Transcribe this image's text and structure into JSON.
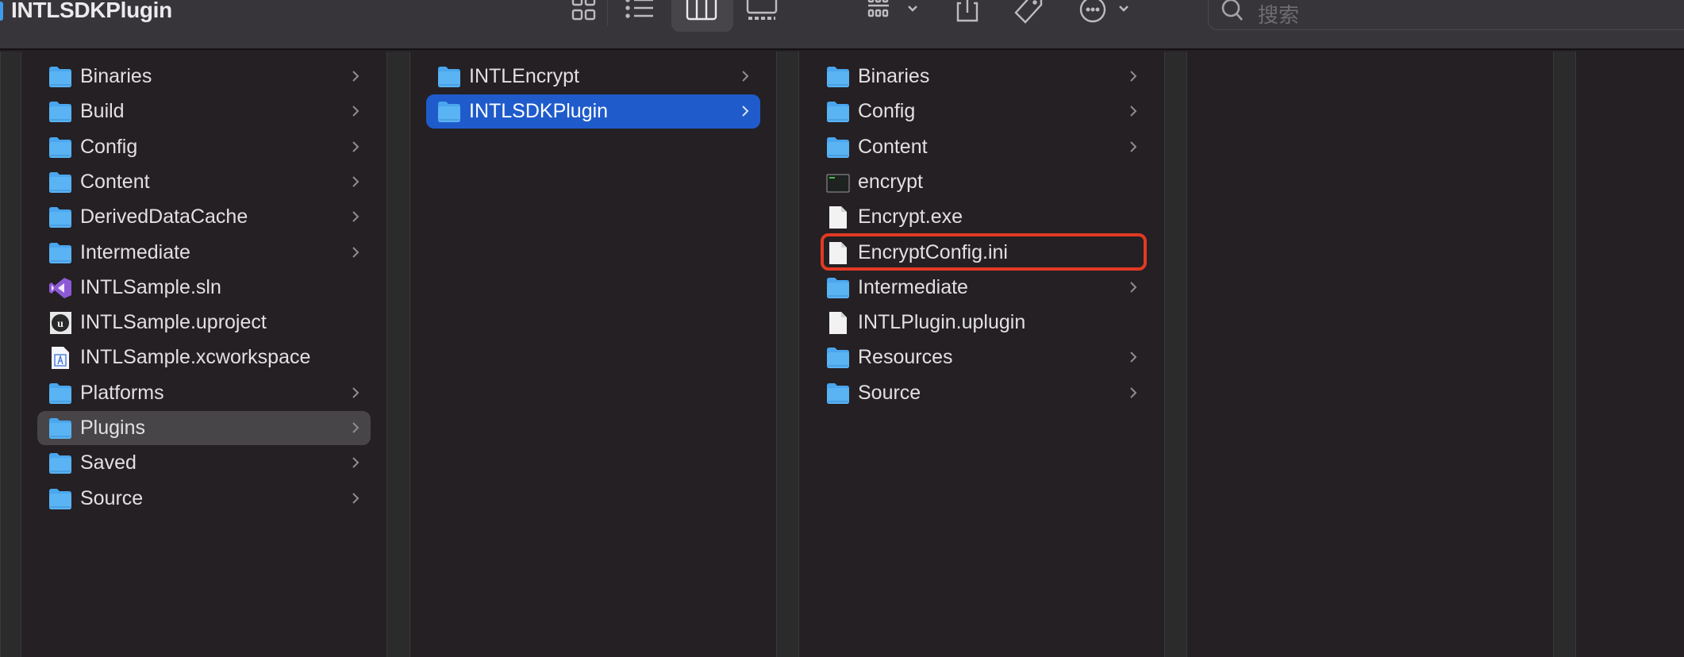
{
  "window": {
    "title": "INTLSDKPlugin"
  },
  "toolbar": {
    "view_buttons": [
      {
        "name": "icon-view",
        "icon": "grid-icon",
        "selected": false
      },
      {
        "name": "list-view",
        "icon": "list-icon",
        "selected": false
      },
      {
        "name": "column-view",
        "icon": "columns-icon",
        "selected": true
      },
      {
        "name": "gallery-view",
        "icon": "gallery-icon",
        "selected": false
      }
    ],
    "group_button": {
      "icon": "group-icon",
      "has_dropdown": true
    },
    "share_button": {
      "icon": "share-icon"
    },
    "tag_button": {
      "icon": "tag-icon"
    },
    "more_button": {
      "icon": "ellipsis-circle-icon",
      "has_dropdown": true
    },
    "search": {
      "placeholder": "搜索",
      "value": ""
    }
  },
  "columns": [
    {
      "items": [
        {
          "name": "Binaries",
          "type": "folder",
          "has_children": true
        },
        {
          "name": "Build",
          "type": "folder",
          "has_children": true
        },
        {
          "name": "Config",
          "type": "folder",
          "has_children": true
        },
        {
          "name": "Content",
          "type": "folder",
          "has_children": true
        },
        {
          "name": "DerivedDataCache",
          "type": "folder",
          "has_children": true
        },
        {
          "name": "Intermediate",
          "type": "folder",
          "has_children": true
        },
        {
          "name": "INTLSample.sln",
          "type": "vs-solution",
          "has_children": false
        },
        {
          "name": "INTLSample.uproject",
          "type": "unreal-project",
          "has_children": false
        },
        {
          "name": "INTLSample.xcworkspace",
          "type": "xcode-workspace",
          "has_children": false
        },
        {
          "name": "Platforms",
          "type": "folder",
          "has_children": true
        },
        {
          "name": "Plugins",
          "type": "folder",
          "has_children": true,
          "selected": "inactive"
        },
        {
          "name": "Saved",
          "type": "folder",
          "has_children": true
        },
        {
          "name": "Source",
          "type": "folder",
          "has_children": true
        }
      ]
    },
    {
      "items": [
        {
          "name": "INTLEncrypt",
          "type": "folder",
          "has_children": true
        },
        {
          "name": "INTLSDKPlugin",
          "type": "folder",
          "has_children": true,
          "selected": "active"
        }
      ]
    },
    {
      "items": [
        {
          "name": "Binaries",
          "type": "folder",
          "has_children": true
        },
        {
          "name": "Config",
          "type": "folder",
          "has_children": true
        },
        {
          "name": "Content",
          "type": "folder",
          "has_children": true
        },
        {
          "name": "encrypt",
          "type": "executable",
          "has_children": false
        },
        {
          "name": "Encrypt.exe",
          "type": "document",
          "has_children": false
        },
        {
          "name": "EncryptConfig.ini",
          "type": "document",
          "has_children": false,
          "annotated": true
        },
        {
          "name": "Intermediate",
          "type": "folder",
          "has_children": true
        },
        {
          "name": "INTLPlugin.uplugin",
          "type": "document",
          "has_children": false
        },
        {
          "name": "Resources",
          "type": "folder",
          "has_children": true
        },
        {
          "name": "Source",
          "type": "folder",
          "has_children": true
        }
      ]
    },
    {
      "items": []
    },
    {
      "items": []
    }
  ],
  "colors": {
    "accent_selection": "#1f5bcb",
    "inactive_selection": "#474548",
    "folder": "#4aa6ee",
    "annotation": "#e23a22"
  }
}
